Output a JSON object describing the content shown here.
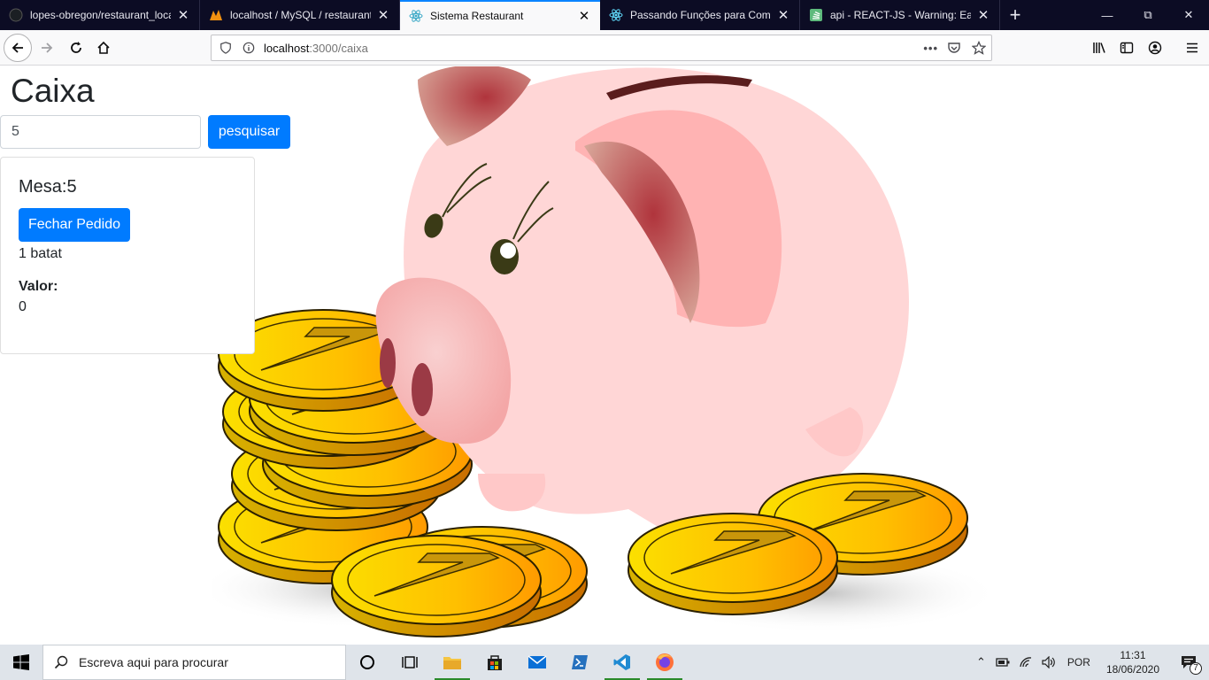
{
  "browser": {
    "tabs": [
      {
        "label": "lopes-obregon/restaurant_local",
        "icon": "github-icon",
        "active": false
      },
      {
        "label": "localhost / MySQL / restaurant",
        "icon": "phpmyadmin-icon",
        "active": false
      },
      {
        "label": "Sistema Restaurant",
        "icon": "react-icon",
        "active": true
      },
      {
        "label": "Passando Funções para Compo",
        "icon": "react-icon",
        "active": false
      },
      {
        "label": "api - REACT-JS - Warning: Each",
        "icon": "stackoverflow-icon",
        "active": false
      }
    ],
    "url_host": "localhost",
    "url_path": ":3000/caixa"
  },
  "page": {
    "title": "Caixa",
    "search": {
      "value": "5",
      "button_label": "pesquisar"
    },
    "card": {
      "title": "Mesa:5",
      "close_button_label": "Fechar Pedido",
      "item": "1 batat",
      "valor_label": "Valor:",
      "valor_value": "0"
    }
  },
  "taskbar": {
    "search_placeholder": "Escreva aqui para procurar",
    "language": "POR",
    "time": "11:31",
    "date": "18/06/2020",
    "notification_count": "7"
  },
  "colors": {
    "primary": "#007bff",
    "tab_strip": "#0c0c24",
    "active_tab_accent": "#0a84ff"
  }
}
